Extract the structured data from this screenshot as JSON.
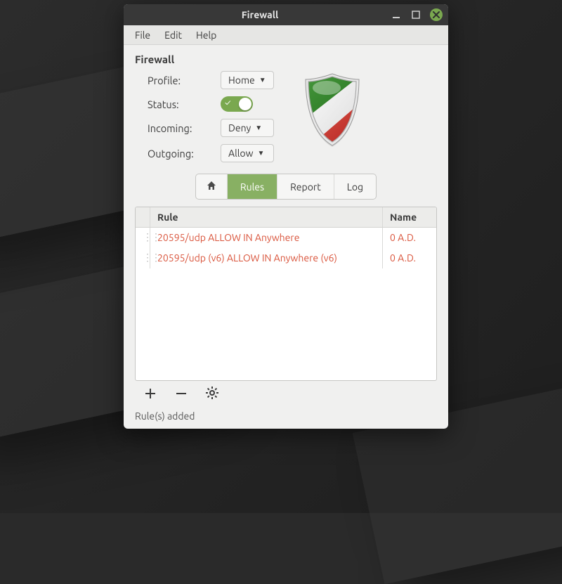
{
  "window": {
    "title": "Firewall"
  },
  "menu": {
    "file": "File",
    "edit": "Edit",
    "help": "Help"
  },
  "section": {
    "title": "Firewall"
  },
  "settings": {
    "profile_label": "Profile:",
    "profile_value": "Home",
    "status_label": "Status:",
    "status_on": true,
    "incoming_label": "Incoming:",
    "incoming_value": "Deny",
    "outgoing_label": "Outgoing:",
    "outgoing_value": "Allow"
  },
  "tabs": {
    "home": "",
    "rules": "Rules",
    "report": "Report",
    "log": "Log",
    "active": "rules"
  },
  "table": {
    "headers": {
      "rule": "Rule",
      "name": "Name"
    },
    "rows": [
      {
        "rule": "20595/udp ALLOW IN Anywhere",
        "name": "0 A.D."
      },
      {
        "rule": "20595/udp (v6) ALLOW IN Anywhere (v6)",
        "name": "0 A.D."
      }
    ]
  },
  "statusbar": {
    "message": "Rule(s) added"
  },
  "colors": {
    "accent": "#7aa84f",
    "rule_text": "#d9533a"
  }
}
